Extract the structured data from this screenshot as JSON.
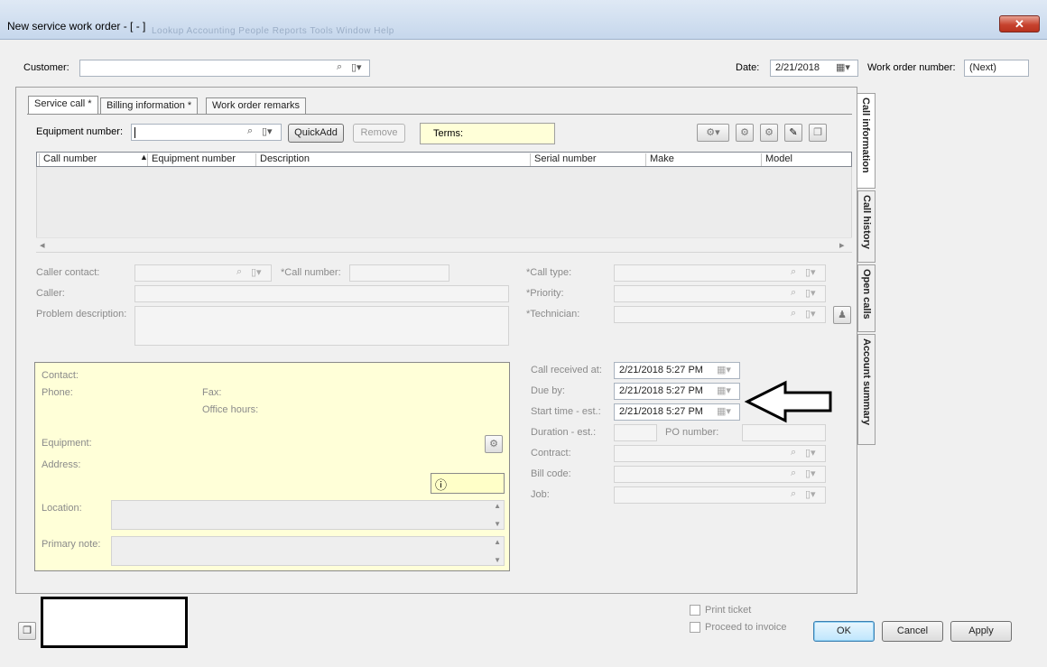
{
  "window": {
    "title": "New service work order - [ - ]",
    "ghost_menu": "Lookup   Accounting   People   Reports   Tools   Window   Help",
    "close_glyph": "✕"
  },
  "header": {
    "customer_label": "Customer:",
    "customer_value": "",
    "date_label": "Date:",
    "date_value": "2/21/2018",
    "wo_label": "Work order number:",
    "wo_value": "(Next)"
  },
  "tabs": [
    "Service call *",
    "Billing information *",
    "Work order remarks"
  ],
  "side_tabs": [
    "Call information",
    "Call history",
    "Open calls",
    "Account summary"
  ],
  "equipment": {
    "label": "Equipment number:",
    "quickadd": "QuickAdd",
    "remove": "Remove",
    "terms_label": "Terms:"
  },
  "grid": {
    "columns": [
      "Call number",
      "Equipment number",
      "Description",
      "Serial number",
      "Make",
      "Model"
    ],
    "sort_glyph": "▲",
    "scroll_left": "◂",
    "scroll_right": "▸"
  },
  "call_form": {
    "caller_contact": "Caller contact:",
    "call_number": "*Call number:",
    "caller": "Caller:",
    "problem": "Problem description:",
    "call_type": "*Call type:",
    "priority": "*Priority:",
    "technician": "*Technician:"
  },
  "contact_panel": {
    "contact": "Contact:",
    "phone": "Phone:",
    "fax": "Fax:",
    "office_hours": "Office hours:",
    "equipment": "Equipment:",
    "address": "Address:",
    "location": "Location:",
    "primary_note": "Primary note:",
    "info_glyph": "ⓘ"
  },
  "schedule": {
    "call_received_label": "Call received at:",
    "call_received_value": "2/21/2018  5:27 PM",
    "due_by_label": "Due by:",
    "due_by_value": "2/21/2018  5:27 PM",
    "start_label": "Start time - est.:",
    "start_value": "2/21/2018  5:27 PM",
    "duration_label": "Duration - est.:",
    "po_label": "PO number:",
    "contract_label": "Contract:",
    "bill_code_label": "Bill code:",
    "job_label": "Job:"
  },
  "footer": {
    "print_ticket": "Print ticket",
    "proceed_invoice": "Proceed to invoice",
    "ok": "OK",
    "cancel": "Cancel",
    "apply": "Apply"
  },
  "icons": {
    "search": "⌕",
    "lookup_menu": "▯▾",
    "calendar": "▦▾",
    "gear": "⚙",
    "clip": "✎",
    "copy": "❐",
    "person": "♟"
  }
}
